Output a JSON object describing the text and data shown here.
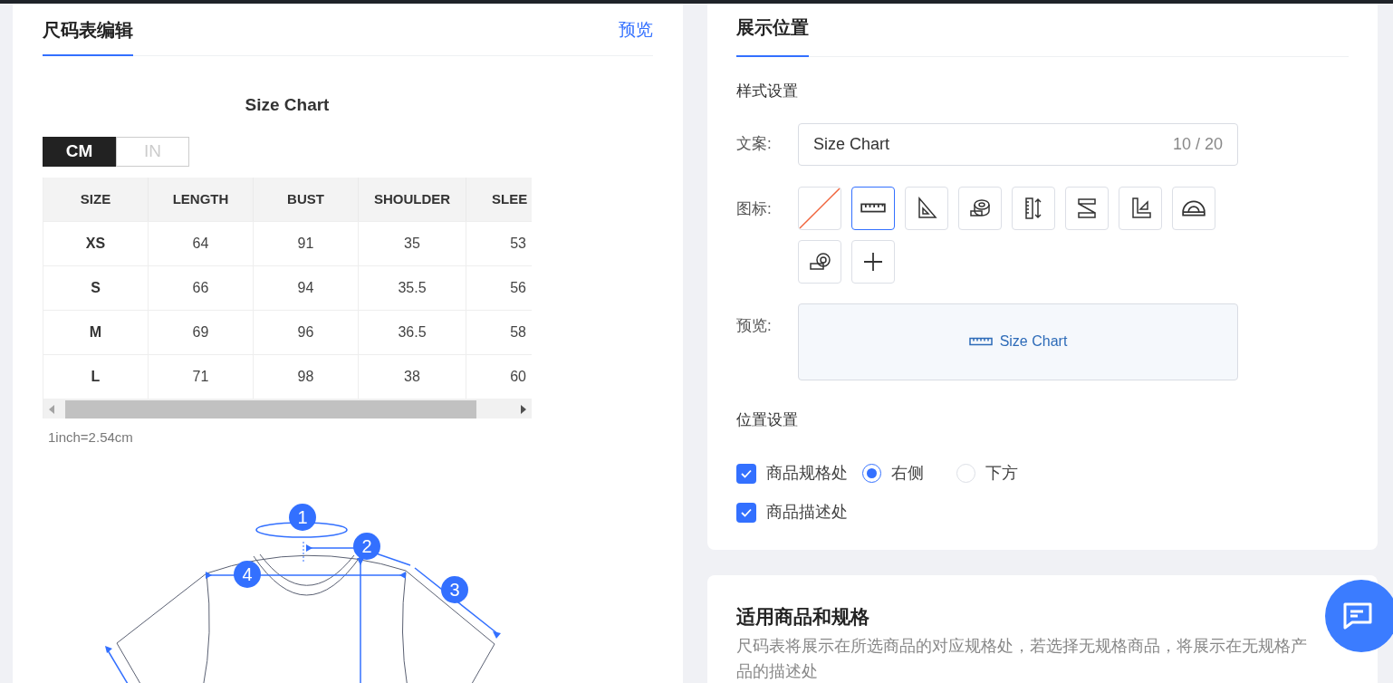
{
  "editor": {
    "tab": "尺码表编辑",
    "preview_link": "预览",
    "chart_title": "Size Chart",
    "units": [
      {
        "label": "CM",
        "selected": true
      },
      {
        "label": "IN",
        "selected": false
      }
    ],
    "table": {
      "columns": [
        "SIZE",
        "LENGTH",
        "BUST",
        "SHOULDER",
        "SLEE"
      ],
      "rows": [
        [
          "XS",
          "64",
          "91",
          "35",
          "53"
        ],
        [
          "S",
          "66",
          "94",
          "35.5",
          "56"
        ],
        [
          "M",
          "69",
          "96",
          "36.5",
          "58"
        ],
        [
          "L",
          "71",
          "98",
          "38",
          "60"
        ]
      ]
    },
    "note": "1inch=2.54cm",
    "diagram_markers": [
      "1",
      "2",
      "3",
      "4"
    ]
  },
  "display": {
    "tab": "展示位置",
    "style_heading": "样式设置",
    "text_label": "文案:",
    "text_value": "Size Chart",
    "text_count": "10 / 20",
    "icon_label": "图标:",
    "icon_options": [
      {
        "kind": "none",
        "selected": false
      },
      {
        "kind": "ruler",
        "selected": true
      },
      {
        "kind": "triangle",
        "selected": false
      },
      {
        "kind": "tape",
        "selected": false
      },
      {
        "kind": "vertical-ruler",
        "selected": false
      },
      {
        "kind": "folded-ruler",
        "selected": false
      },
      {
        "kind": "square-ruler",
        "selected": false
      },
      {
        "kind": "protractor",
        "selected": false
      },
      {
        "kind": "tape-measure",
        "selected": false
      },
      {
        "kind": "add",
        "selected": false
      }
    ],
    "preview_label": "预览:",
    "preview_text": "Size Chart",
    "position_heading": "位置设置",
    "positions": [
      {
        "label": "商品规格处",
        "checked": true
      },
      {
        "label": "商品描述处",
        "checked": true
      }
    ],
    "placements": [
      {
        "label": "右侧",
        "selected": true
      },
      {
        "label": "下方",
        "selected": false
      }
    ]
  },
  "products": {
    "title": "适用商品和规格",
    "description": "尺码表将展示在所选商品的对应规格处，若选择无规格商品，将展示在无规格产品的描述处"
  }
}
